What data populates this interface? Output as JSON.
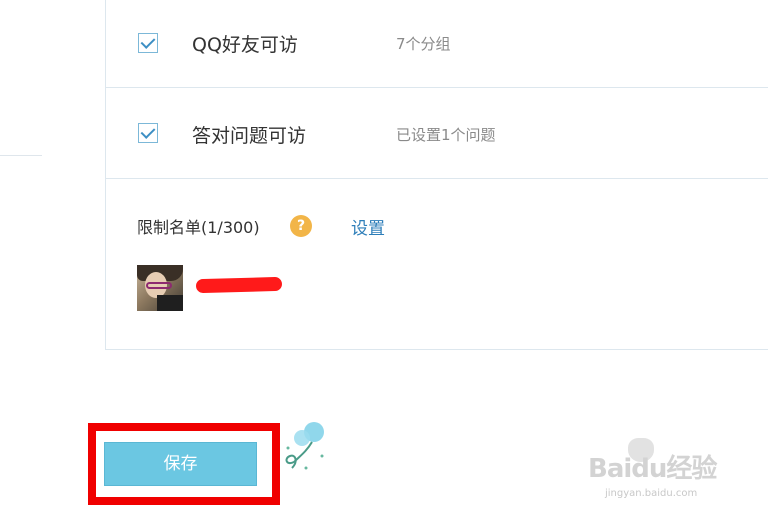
{
  "options": [
    {
      "label": "QQ好友可访",
      "description": "7个分组",
      "checked": true
    },
    {
      "label": "答对问题可访",
      "description": "已设置1个问题",
      "checked": true
    }
  ],
  "restriction": {
    "label": "限制名单(1/300)",
    "help_glyph": "?",
    "settings_link": "设置"
  },
  "actions": {
    "save_label": "保存"
  },
  "watermark": {
    "brand": "Baidu经验",
    "url": "jingyan.baidu.com"
  },
  "colors": {
    "accent_button": "#6bc7e2",
    "link": "#2d7eb9",
    "help_icon": "#f2b548",
    "highlight": "#f00000",
    "redaction": "#ff1a1a"
  },
  "icons": [
    "checkbox-checked-icon",
    "help-icon",
    "avatar",
    "balloon-icon"
  ]
}
